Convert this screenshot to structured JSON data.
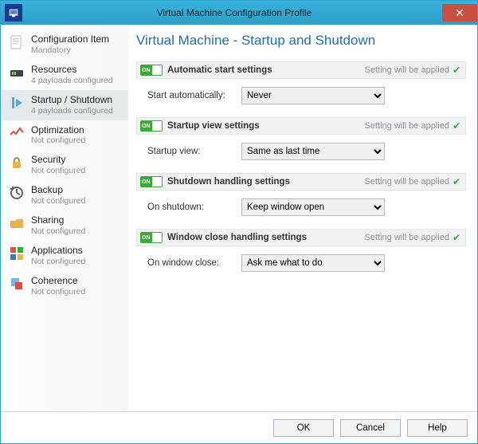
{
  "window": {
    "title": "Virtual Machine Configuration Profile",
    "close_glyph": "✕"
  },
  "sidebar": {
    "items": [
      {
        "icon": "config-item-icon",
        "label": "Configuration Item",
        "sub": "Mandatory"
      },
      {
        "icon": "resources-icon",
        "label": "Resources",
        "sub": "4 payloads configured"
      },
      {
        "icon": "startup-icon",
        "label": "Startup / Shutdown",
        "sub": "4 payloads configured"
      },
      {
        "icon": "optimization-icon",
        "label": "Optimization",
        "sub": "Not configured"
      },
      {
        "icon": "security-icon",
        "label": "Security",
        "sub": "Not configured"
      },
      {
        "icon": "backup-icon",
        "label": "Backup",
        "sub": "Not configured"
      },
      {
        "icon": "sharing-icon",
        "label": "Sharing",
        "sub": "Not configured"
      },
      {
        "icon": "applications-icon",
        "label": "Applications",
        "sub": "Not configured"
      },
      {
        "icon": "coherence-icon",
        "label": "Coherence",
        "sub": "Not configured"
      }
    ]
  },
  "main": {
    "heading": "Virtual Machine - Startup and Shutdown",
    "status_label": "Setting will be applied",
    "toggle_on_text": "ON",
    "check_glyph": "✔",
    "sections": [
      {
        "title": "Automatic start settings",
        "field_label": "Start automatically:",
        "value": "Never"
      },
      {
        "title": "Startup view settings",
        "field_label": "Startup view:",
        "value": "Same as last time"
      },
      {
        "title": "Shutdown handling settings",
        "field_label": "On shutdown:",
        "value": "Keep window open"
      },
      {
        "title": "Window close handling settings",
        "field_label": "On window close:",
        "value": "Ask me what to do"
      }
    ]
  },
  "footer": {
    "ok": "OK",
    "cancel": "Cancel",
    "help": "Help"
  }
}
